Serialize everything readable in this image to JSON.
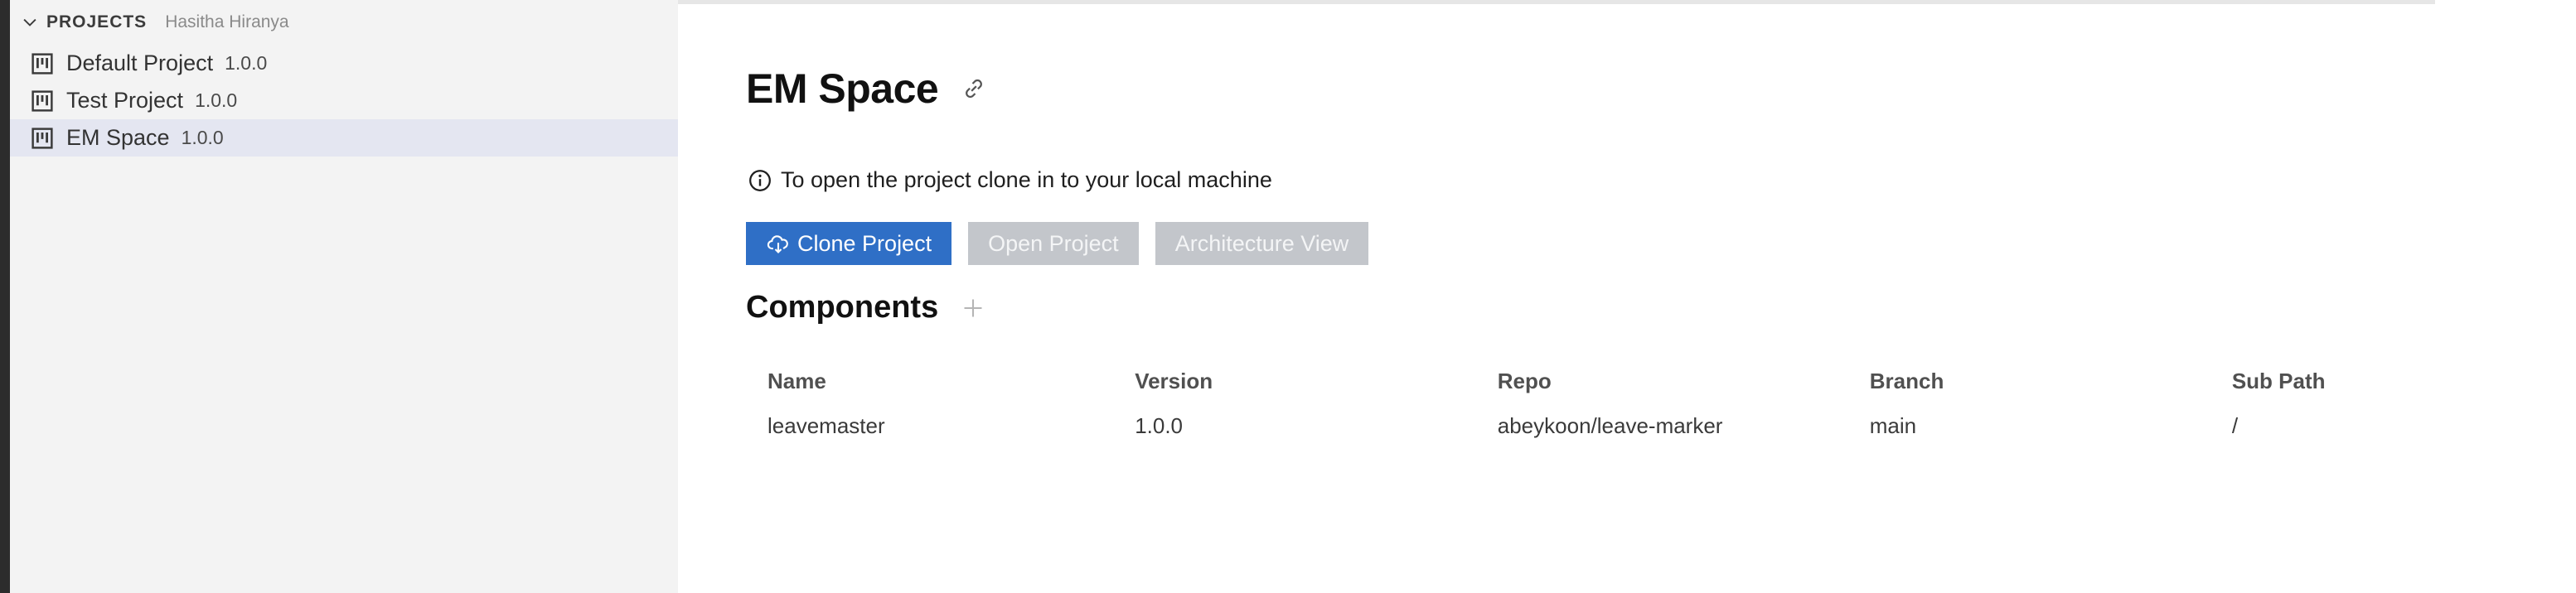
{
  "sidebar": {
    "title": "PROJECTS",
    "user": "Hasitha Hiranya",
    "projects": [
      {
        "name": "Default Project",
        "version": "1.0.0",
        "selected": false
      },
      {
        "name": "Test Project",
        "version": "1.0.0",
        "selected": false
      },
      {
        "name": "EM Space",
        "version": "1.0.0",
        "selected": true
      }
    ]
  },
  "main": {
    "title": "EM Space",
    "info_text": "To open the project clone in to your local machine",
    "buttons": {
      "clone": "Clone Project",
      "open": "Open Project",
      "architecture": "Architecture View"
    },
    "components": {
      "title": "Components",
      "columns": [
        "Name",
        "Version",
        "Repo",
        "Branch",
        "Sub Path"
      ],
      "rows": [
        [
          "leavemaster",
          "1.0.0",
          "abeykoon/leave-marker",
          "main",
          "/"
        ]
      ]
    }
  },
  "icons": {
    "chevron": "chevron-down-icon",
    "project": "project-board-icon",
    "link": "link-icon",
    "info": "info-icon",
    "cloud": "cloud-download-icon",
    "add": "plus-icon"
  },
  "colors": {
    "primary_button": "#2f6fc6",
    "disabled_button": "#c3c6cb",
    "selected_row": "#e4e6f1",
    "sidebar_bg": "#f3f3f3",
    "activity_strip": "#2c2c2c"
  }
}
